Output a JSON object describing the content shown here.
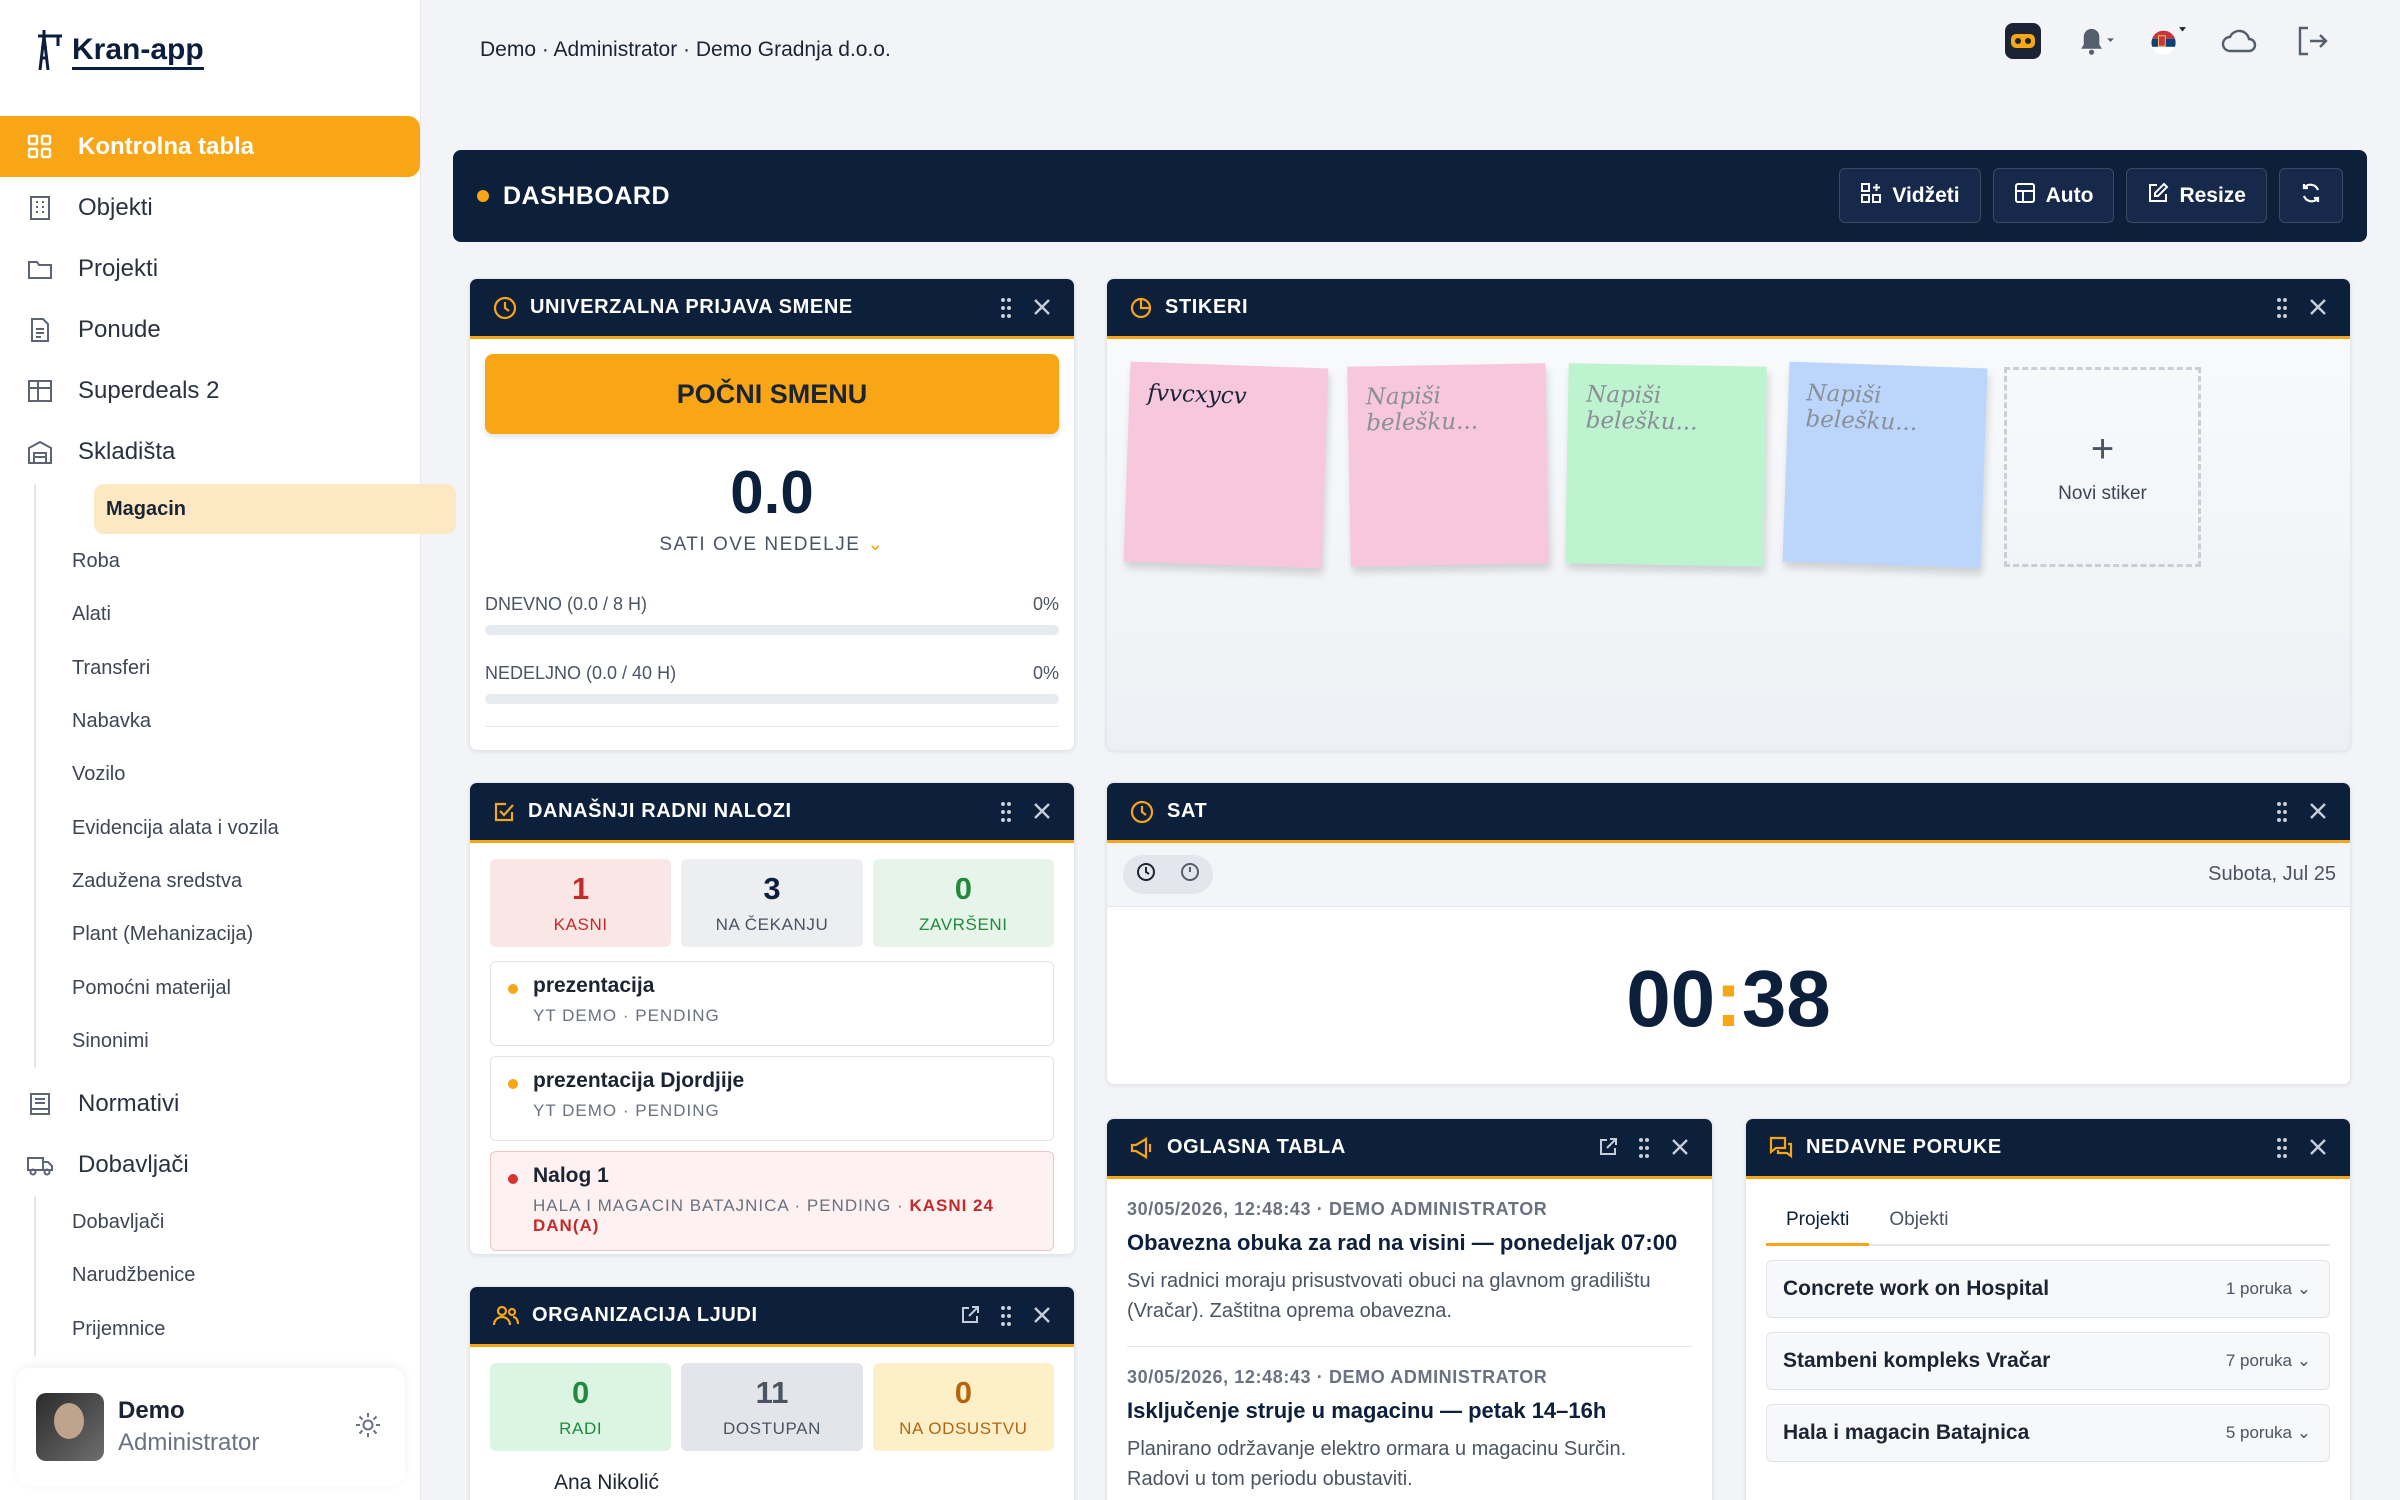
{
  "app": {
    "logo_text": "Kran-app"
  },
  "sidebar": {
    "items": [
      {
        "label": "Kontrolna tabla",
        "icon": "grid-icon"
      },
      {
        "label": "Objekti",
        "icon": "building-icon"
      },
      {
        "label": "Projekti",
        "icon": "folder-icon"
      },
      {
        "label": "Ponude",
        "icon": "document-icon"
      },
      {
        "label": "Superdeals 2",
        "icon": "table-icon"
      },
      {
        "label": "Skladišta",
        "icon": "warehouse-icon"
      }
    ],
    "warehouse_sub": [
      "Magacin",
      "Roba",
      "Alati",
      "Transferi",
      "Nabavka",
      "Vozilo",
      "Evidencija alata i vozila",
      "Zadužena sredstva",
      "Plant (Mehanizacija)",
      "Pomoćni materijal",
      "Sinonimi"
    ],
    "items2": [
      {
        "label": "Normativi",
        "icon": "book-icon"
      },
      {
        "label": "Dobavljači",
        "icon": "truck-icon"
      }
    ],
    "supplier_sub": [
      "Dobavljači",
      "Narudžbenice",
      "Prijemnice"
    ],
    "user": {
      "name": "Demo",
      "role": "Administrator"
    }
  },
  "topbar": {
    "context": "Demo · Administrator · Demo Gradnja d.o.o."
  },
  "dashboard": {
    "title": "DASHBOARD",
    "buttons": {
      "widgets": "Vidžeti",
      "auto": "Auto",
      "resize": "Resize"
    }
  },
  "shift": {
    "title": "UNIVERZALNA PRIJAVA SMENE",
    "start_label": "POČNI SMENU",
    "hours": "0.0",
    "hours_label": "SATI OVE NEDELJE",
    "daily_label": "DNEVNO (0.0 / 8 H)",
    "daily_pct": "0%",
    "daily_progress": 0,
    "weekly_label": "NEDELJNO (0.0 / 40 H)",
    "weekly_pct": "0%",
    "weekly_progress": 0
  },
  "stickers": {
    "title": "STIKERI",
    "items": [
      {
        "text": "fvvcxycv",
        "color": "#f7c7de"
      },
      {
        "text": "Napiši belešku...",
        "color": "#f7c7de"
      },
      {
        "text": "Napiši belešku...",
        "color": "#bdf3cf"
      },
      {
        "text": "Napiši belešku...",
        "color": "#bcd6fb"
      }
    ],
    "new_label": "Novi stiker"
  },
  "orders": {
    "title": "DANAŠNJI RADNI NALOZI",
    "stats": [
      {
        "value": "1",
        "label": "KASNI"
      },
      {
        "value": "3",
        "label": "NA ČEKANJU"
      },
      {
        "value": "0",
        "label": "ZAVRŠENI"
      }
    ],
    "items": [
      {
        "title": "prezentacija",
        "meta": "YT DEMO · PENDING"
      },
      {
        "title": "prezentacija Djordjije",
        "meta": "YT DEMO · PENDING"
      },
      {
        "title": "Nalog 1",
        "meta": "HALA I MAGACIN BATAJNICA · PENDING · ",
        "late": "KASNI 24",
        "late2": "DAN(A)"
      }
    ]
  },
  "clock": {
    "title": "SAT",
    "date": "Subota, Jul 25",
    "hours": "00",
    "minutes": "38"
  },
  "notice": {
    "title": "OGLASNA TABLA",
    "posts": [
      {
        "meta": "30/05/2026, 12:48:43 · DEMO ADMINISTRATOR",
        "title": "Obavezna obuka za rad na visini — ponedeljak 07:00",
        "body": "Svi radnici moraju prisustvovati obuci na glavnom gradilištu (Vračar). Zaštitna oprema obavezna."
      },
      {
        "meta": "30/05/2026, 12:48:43 · DEMO ADMINISTRATOR",
        "title": "Isključenje struje u magacinu — petak 14–16h",
        "body": "Planirano održavanje elektro ormara u magacinu Surčin. Radovi u tom periodu obustaviti."
      }
    ]
  },
  "messages": {
    "title": "NEDAVNE PORUKE",
    "tabs": [
      "Projekti",
      "Objekti"
    ],
    "items": [
      {
        "name": "Concrete work on Hospital",
        "count": "1 poruka"
      },
      {
        "name": "Stambeni kompleks Vračar",
        "count": "7 poruka"
      },
      {
        "name": "Hala i magacin Batajnica",
        "count": "5 poruka"
      }
    ]
  },
  "people": {
    "title": "ORGANIZACIJA LJUDI",
    "stats": [
      {
        "value": "0",
        "label": "RADI"
      },
      {
        "value": "11",
        "label": "DOSTUPAN"
      },
      {
        "value": "0",
        "label": "NA ODSUSTVU"
      }
    ],
    "first_person": "Ana Nikolić"
  }
}
